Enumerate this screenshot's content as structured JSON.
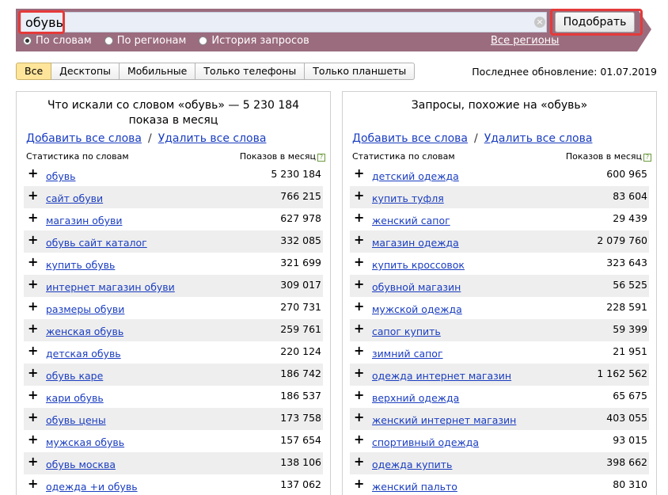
{
  "search": {
    "query": "обувь",
    "clear_glyph": "×",
    "submit_label": "Подобрать",
    "modes": [
      {
        "label": "По словам",
        "selected": true
      },
      {
        "label": "По регионам",
        "selected": false
      },
      {
        "label": "История запросов",
        "selected": false
      }
    ],
    "regions_link": "Все регионы"
  },
  "tabs": [
    {
      "label": "Все",
      "active": true
    },
    {
      "label": "Десктопы",
      "active": false
    },
    {
      "label": "Мобильные",
      "active": false
    },
    {
      "label": "Только телефоны",
      "active": false
    },
    {
      "label": "Только планшеты",
      "active": false
    }
  ],
  "last_update": "Последнее обновление: 01.07.2019",
  "left_panel": {
    "title_line1": "Что искали со словом «обувь» — 5 230 184",
    "title_line2": "показа в месяц",
    "add_all": "Добавить все слова",
    "separator": "/",
    "remove_all": "Удалить все слова",
    "col_phrase": "Статистика по словам",
    "col_count": "Показов в месяц",
    "help_glyph": "?",
    "rows": [
      {
        "phrase": "обувь",
        "count": "5 230 184"
      },
      {
        "phrase": "сайт обуви",
        "count": "766 215"
      },
      {
        "phrase": "магазин обуви",
        "count": "627 978"
      },
      {
        "phrase": "обувь сайт каталог",
        "count": "332 085"
      },
      {
        "phrase": "купить обувь",
        "count": "321 699"
      },
      {
        "phrase": "интернет магазин обуви",
        "count": "309 017"
      },
      {
        "phrase": "размеры обуви",
        "count": "270 731"
      },
      {
        "phrase": "женская обувь",
        "count": "259 761"
      },
      {
        "phrase": "детская обувь",
        "count": "220 124"
      },
      {
        "phrase": "обувь каре",
        "count": "186 742"
      },
      {
        "phrase": "кари обувь",
        "count": "186 537"
      },
      {
        "phrase": "обувь цены",
        "count": "173 758"
      },
      {
        "phrase": "мужская обувь",
        "count": "157 654"
      },
      {
        "phrase": "обувь москва",
        "count": "138 106"
      },
      {
        "phrase": "одежда +и обувь",
        "count": "137 062"
      }
    ]
  },
  "right_panel": {
    "title_line1": "Запросы, похожие на «обувь»",
    "add_all": "Добавить все слова",
    "separator": "/",
    "remove_all": "Удалить все слова",
    "col_phrase": "Статистика по словам",
    "col_count": "Показов в месяц",
    "help_glyph": "?",
    "rows": [
      {
        "phrase": "детский одежда",
        "count": "600 965"
      },
      {
        "phrase": "купить туфля",
        "count": "83 604"
      },
      {
        "phrase": "женский сапог",
        "count": "29 439"
      },
      {
        "phrase": "магазин одежда",
        "count": "2 079 760"
      },
      {
        "phrase": "купить кроссовок",
        "count": "323 643"
      },
      {
        "phrase": "обувной магазин",
        "count": "56 525"
      },
      {
        "phrase": "мужской одежда",
        "count": "228 591"
      },
      {
        "phrase": "сапог купить",
        "count": "59 399"
      },
      {
        "phrase": "зимний сапог",
        "count": "21 951"
      },
      {
        "phrase": "одежда интернет магазин",
        "count": "1 162 562"
      },
      {
        "phrase": "верхний одежда",
        "count": "65 675"
      },
      {
        "phrase": "женский интернет магазин",
        "count": "403 055"
      },
      {
        "phrase": "спортивный одежда",
        "count": "93 015"
      },
      {
        "phrase": "одежда купить",
        "count": "398 662"
      },
      {
        "phrase": "женский пальто",
        "count": "80 310"
      }
    ]
  },
  "plus_glyph": "+"
}
